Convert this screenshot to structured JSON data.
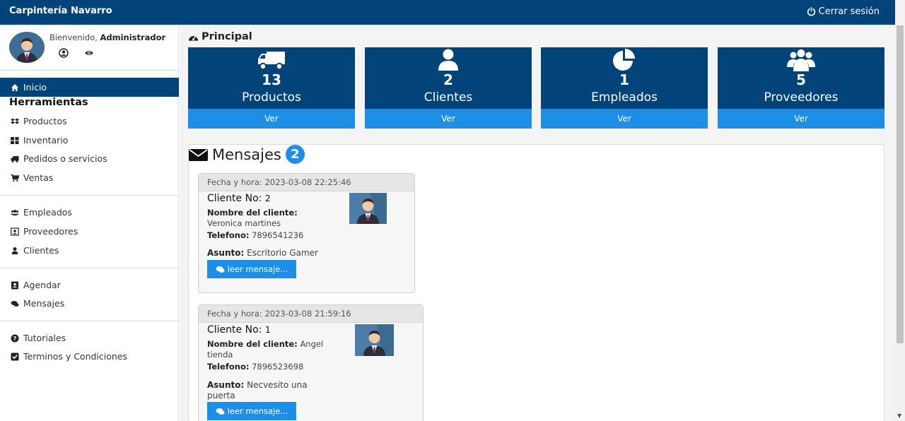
{
  "navbar": {
    "brand": "Carpintería Navarro",
    "logout_label": "Cerrar sesión"
  },
  "sidebar": {
    "welcome_prefix": "Bienvenido, ",
    "welcome_user": "Administrador",
    "active_item": "Inicio",
    "section_title": "Herramientas",
    "groups": [
      [
        "Productos",
        "Inventario",
        "Pedidos o servicios",
        "Ventas"
      ],
      [
        "Empleados",
        "Proveedores",
        "Clientes"
      ],
      [
        "Agendar",
        "Mensajes"
      ],
      [
        "Tutoriales",
        "Terminos y Condiciones"
      ]
    ]
  },
  "main": {
    "heading": "Principal",
    "stats": [
      {
        "count": "13",
        "label": "Productos",
        "link": "Ver",
        "icon": "truck-icon"
      },
      {
        "count": "2",
        "label": "Clientes",
        "link": "Ver",
        "icon": "user-icon"
      },
      {
        "count": "1",
        "label": "Empleados",
        "link": "Ver",
        "icon": "pie-chart-icon"
      },
      {
        "count": "5",
        "label": "Proveedores",
        "link": "Ver",
        "icon": "users-icon"
      }
    ],
    "messages_title": "Mensajes",
    "messages_count": "2",
    "messages": [
      {
        "date_label": "Fecha y hora: 2023-03-08 22:25:46",
        "client_label": "Cliente No:",
        "client_no": "2",
        "name_label": "Nombre del cliente:",
        "name": "Veronica martines",
        "phone_label": "Telefono:",
        "phone": "7896541236",
        "subject_label": "Asunto:",
        "subject": "Escritorio Gamer",
        "button": "leer mensaje..."
      },
      {
        "date_label": "Fecha y hora: 2023-03-08 21:59:16",
        "client_label": "Cliente No:",
        "client_no": "1",
        "name_label": "Nombre del cliente:",
        "name": "Angel tienda",
        "phone_label": "Telefono:",
        "phone": "7896523698",
        "subject_label": "Asunto:",
        "subject": "Necvesito una puerta",
        "button": "leer mensaje..."
      }
    ]
  },
  "colors": {
    "primary": "#02447a",
    "accent": "#1e8fe7"
  }
}
